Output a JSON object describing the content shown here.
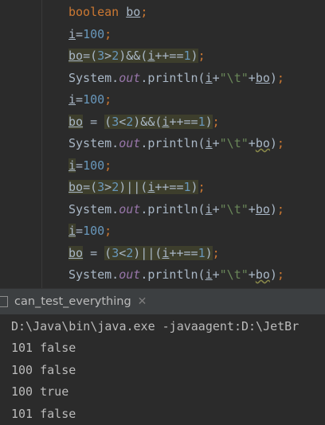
{
  "editor": {
    "lines": [
      {
        "code": "boolean bo;"
      },
      {
        "code": "i=100;"
      },
      {
        "code": "bo=(3>2)&&(i++==1);"
      },
      {
        "code": "System.out.println(i+\"\\t\"+bo);"
      },
      {
        "code": "i=100;"
      },
      {
        "code": "bo = (3<2)&&(i++==1);"
      },
      {
        "code": "System.out.println(i+\"\\t\"+bo);"
      },
      {
        "code": "i=100;"
      },
      {
        "code": "bo=(3>2)||(i++==1);"
      },
      {
        "code": "System.out.println(i+\"\\t\"+bo);"
      },
      {
        "code": "i=100;"
      },
      {
        "code": "bo = (3<2)||(i++==1);"
      },
      {
        "code": "System.out.println(i+\"\\t\"+bo);"
      }
    ]
  },
  "run_tab": {
    "label": "can_test_everything",
    "close_icon": "close-icon"
  },
  "console": {
    "lines": [
      "D:\\Java\\bin\\java.exe -javaagent:D:\\JetBr",
      "101 false",
      "100 false",
      "100 true",
      "101 false"
    ]
  }
}
